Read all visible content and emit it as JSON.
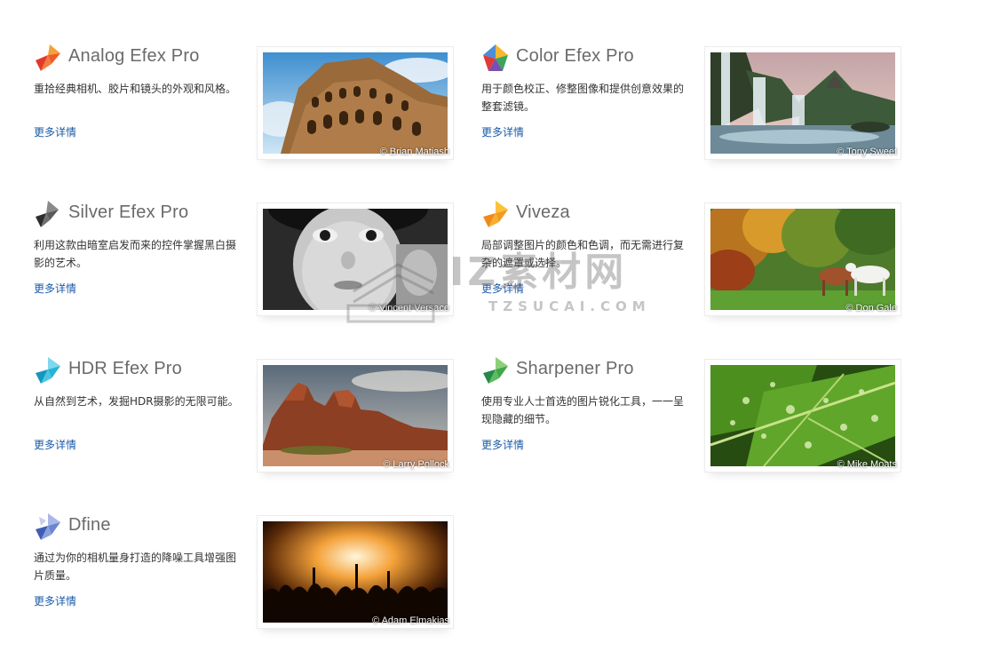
{
  "more_label": "更多详情",
  "products": [
    {
      "name": "Analog Efex Pro",
      "desc": "重拾经典相机、胶片和镜头的外观和风格。",
      "credit": "© Brian Matiash"
    },
    {
      "name": "Color Efex Pro",
      "desc": "用于颜色校正、修整图像和提供创意效果的整套滤镜。",
      "credit": "© Tony Sweet"
    },
    {
      "name": "Silver Efex Pro",
      "desc": "利用这款由暗室启发而来的控件掌握黑白摄影的艺术。",
      "credit": "© Vincent Versace"
    },
    {
      "name": "Viveza",
      "desc": "局部调整图片的颜色和色调，而无需进行复杂的遮罩或选择。",
      "credit": "© Don Gale"
    },
    {
      "name": "HDR Efex Pro",
      "desc": "从自然到艺术，发掘HDR摄影的无限可能。",
      "credit": "© Larry Pollock"
    },
    {
      "name": "Sharpener Pro",
      "desc": "使用专业人士首选的图片锐化工具，一一呈现隐藏的细节。",
      "credit": "© Mike Moats"
    },
    {
      "name": "Dfine",
      "desc": "通过为你的相机量身打造的降噪工具增强图片质量。",
      "credit": "© Adam Elmakias"
    }
  ],
  "watermark": {
    "big": "IZ素材网",
    "small": "TZSUCAI.COM"
  },
  "colors": {
    "link": "#1a5aa8",
    "title": "#6a6a6a"
  }
}
